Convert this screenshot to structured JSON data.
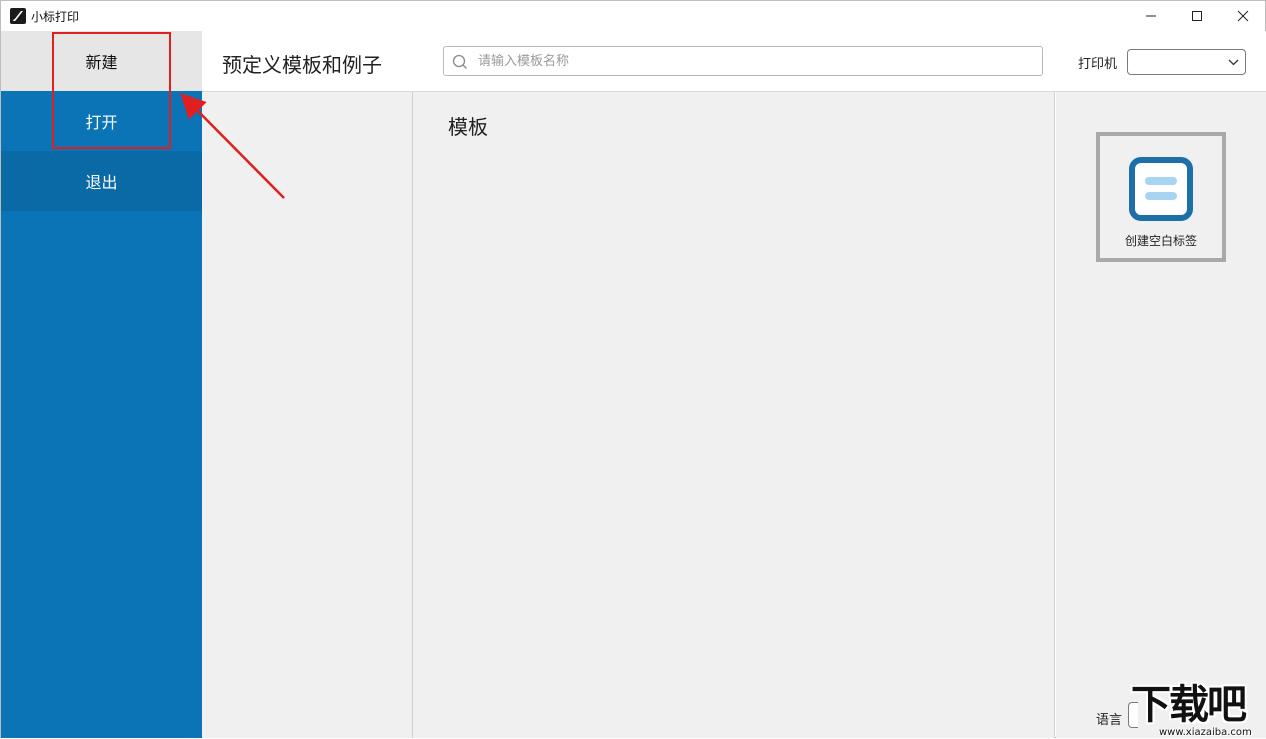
{
  "window": {
    "title": "小标打印",
    "icon": "app-logo-icon",
    "controls": [
      "minimize-icon",
      "maximize-icon",
      "close-icon"
    ]
  },
  "sidebar": {
    "items": [
      {
        "label": "新建",
        "state": "selected"
      },
      {
        "label": "打开",
        "state": "normal"
      },
      {
        "label": "退出",
        "state": "hover"
      }
    ]
  },
  "header": {
    "title": "预定义模板和例子",
    "search": {
      "placeholder": "请输入模板名称",
      "value": ""
    },
    "printer": {
      "label": "打印机",
      "selected": ""
    }
  },
  "templates": {
    "section_title": "模板"
  },
  "right_panel": {
    "blank_label_card": "创建空白标签",
    "language_label": "语言"
  },
  "watermark": {
    "main": "下载吧",
    "sub": "www.xiazaiba.com"
  },
  "colors": {
    "sidebar": "#0b74b6",
    "selected_item": "#e6e6e6",
    "annotation": "#e02020",
    "blank_icon": "#1d6fa8",
    "blank_icon_lines": "#a6d4f2"
  }
}
